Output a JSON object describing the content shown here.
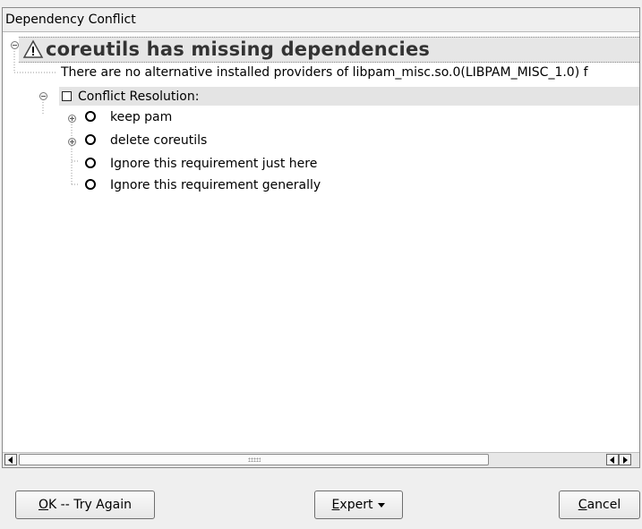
{
  "window": {
    "title": "Dependency Conflict"
  },
  "conflict": {
    "title": "coreutils has missing dependencies",
    "message": "There are no alternative installed providers of libpam_misc.so.0(LIBPAM_MISC_1.0) f",
    "resolution_label": "Conflict Resolution:",
    "options": [
      {
        "label": "keep pam",
        "expandable": true
      },
      {
        "label": "delete coreutils",
        "expandable": true
      },
      {
        "label": "Ignore this requirement just here",
        "expandable": false
      },
      {
        "label": "Ignore this requirement generally",
        "expandable": false
      }
    ]
  },
  "buttons": {
    "ok": {
      "mnemonic": "O",
      "rest": "K -- Try Again"
    },
    "expert": {
      "mnemonic": "E",
      "rest": "xpert"
    },
    "cancel": {
      "mnemonic": "C",
      "rest": "ancel"
    }
  },
  "icons": {
    "warning": "warning-triangle-icon",
    "collapse": "minus-circle-icon",
    "expand": "plus-circle-icon"
  }
}
